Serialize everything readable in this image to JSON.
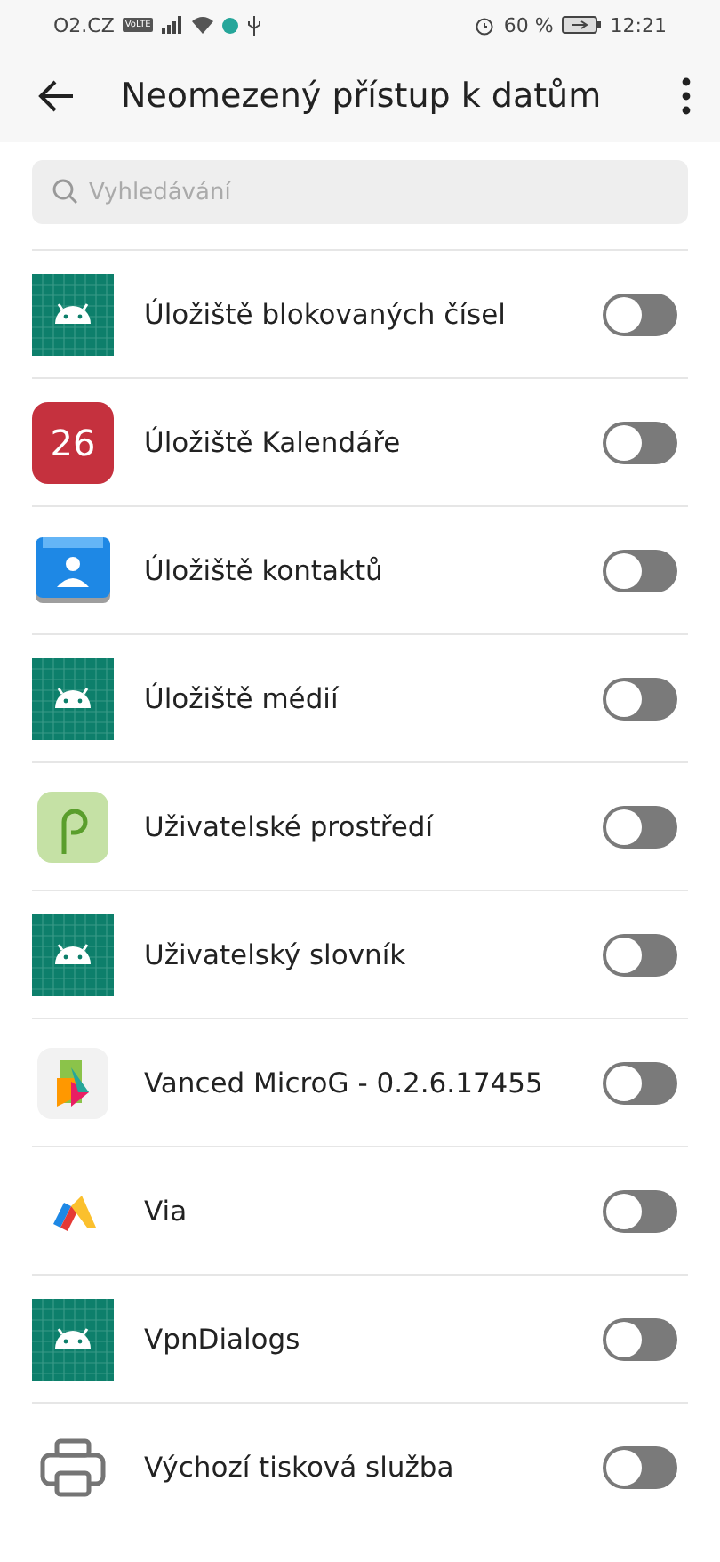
{
  "status_bar": {
    "carrier": "O2.CZ",
    "volte": "VoLTE",
    "battery": "60 %",
    "time": "12:21"
  },
  "toolbar": {
    "title": "Neomezený přístup k datům"
  },
  "search": {
    "placeholder": "Vyhledávání"
  },
  "apps": [
    {
      "name": "Úložiště blokovaných čísel",
      "kind": "android",
      "on": false
    },
    {
      "name": "Úložiště Kalendáře",
      "kind": "calendar",
      "icon_text": "26",
      "on": false
    },
    {
      "name": "Úložiště kontaktů",
      "kind": "contacts",
      "on": false
    },
    {
      "name": "Úložiště médií",
      "kind": "android",
      "on": false
    },
    {
      "name": "Uživatelské prostředí",
      "kind": "pie",
      "on": false
    },
    {
      "name": "Uživatelský slovník",
      "kind": "android",
      "on": false
    },
    {
      "name": "Vanced MicroG - 0.2.6.17455",
      "kind": "puzzle",
      "on": false
    },
    {
      "name": "Via",
      "kind": "via",
      "on": false
    },
    {
      "name": "VpnDialogs",
      "kind": "android",
      "on": false
    },
    {
      "name": "Výchozí tisková služba",
      "kind": "printer",
      "on": false
    }
  ]
}
